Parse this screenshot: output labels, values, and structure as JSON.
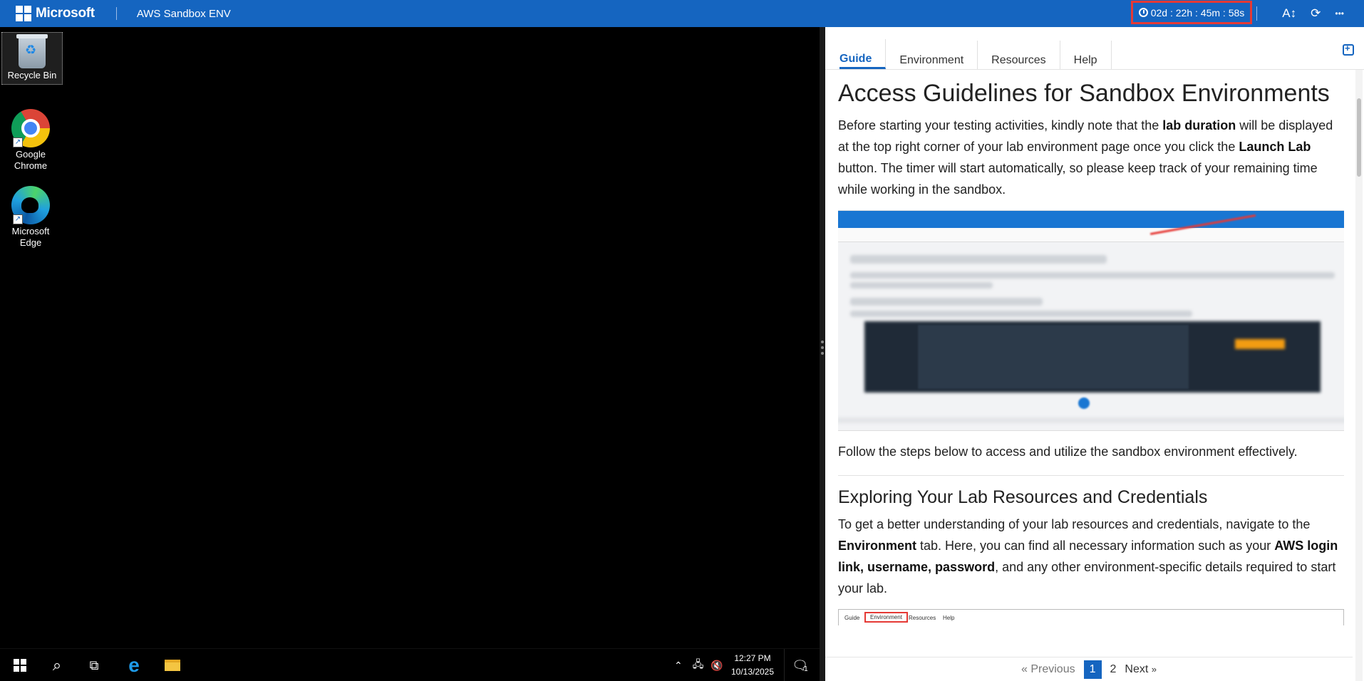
{
  "topbar": {
    "brand": "Microsoft",
    "app_title": "AWS Sandbox ENV",
    "timer": "02d : 22h : 45m : 58s",
    "font_icon": "A↕",
    "refresh_icon": "⟳",
    "more_icon": "•••"
  },
  "desktop": {
    "icons": [
      {
        "label": "Recycle Bin"
      },
      {
        "label": "Google Chrome"
      },
      {
        "label": "Microsoft Edge"
      }
    ]
  },
  "taskbar": {
    "time": "12:27 PM",
    "date": "10/13/2025",
    "notification_count": "1"
  },
  "guide": {
    "tabs": [
      "Guide",
      "Environment",
      "Resources",
      "Help"
    ],
    "active_tab": "Guide",
    "title": "Access Guidelines for Sandbox Environments",
    "intro": {
      "t1": "Before starting your testing activities, kindly note that the ",
      "b1": "lab duration",
      "t2": " will be displayed at the top right corner of your lab environment page once you click the ",
      "b2": "Launch Lab",
      "t3": " button. The timer will start automatically, so please keep track of your remaining time while working in the sandbox."
    },
    "follow_text": "Follow the steps below to access and utilize the sandbox environment effectively.",
    "section2_title": "Exploring Your Lab Resources and Credentials",
    "section2": {
      "t1": "To get a better understanding of your lab resources and credentials, navigate to the ",
      "b1": "Environment",
      "t2": " tab. Here, you can find all necessary information such as your ",
      "b2": "AWS login link, username, password",
      "t3": ", and any other environment-specific details required to start your lab."
    },
    "mini_tabs": [
      "Guide",
      "Environment",
      "Resources",
      "Help"
    ],
    "pager": {
      "previous": "« Previous",
      "pages": [
        "1",
        "2"
      ],
      "current": "1",
      "next": "Next",
      "next_arrow": "»"
    }
  },
  "colors": {
    "topbar": "#1565c0",
    "accent": "#1565c0",
    "timer_border": "#e53935"
  }
}
